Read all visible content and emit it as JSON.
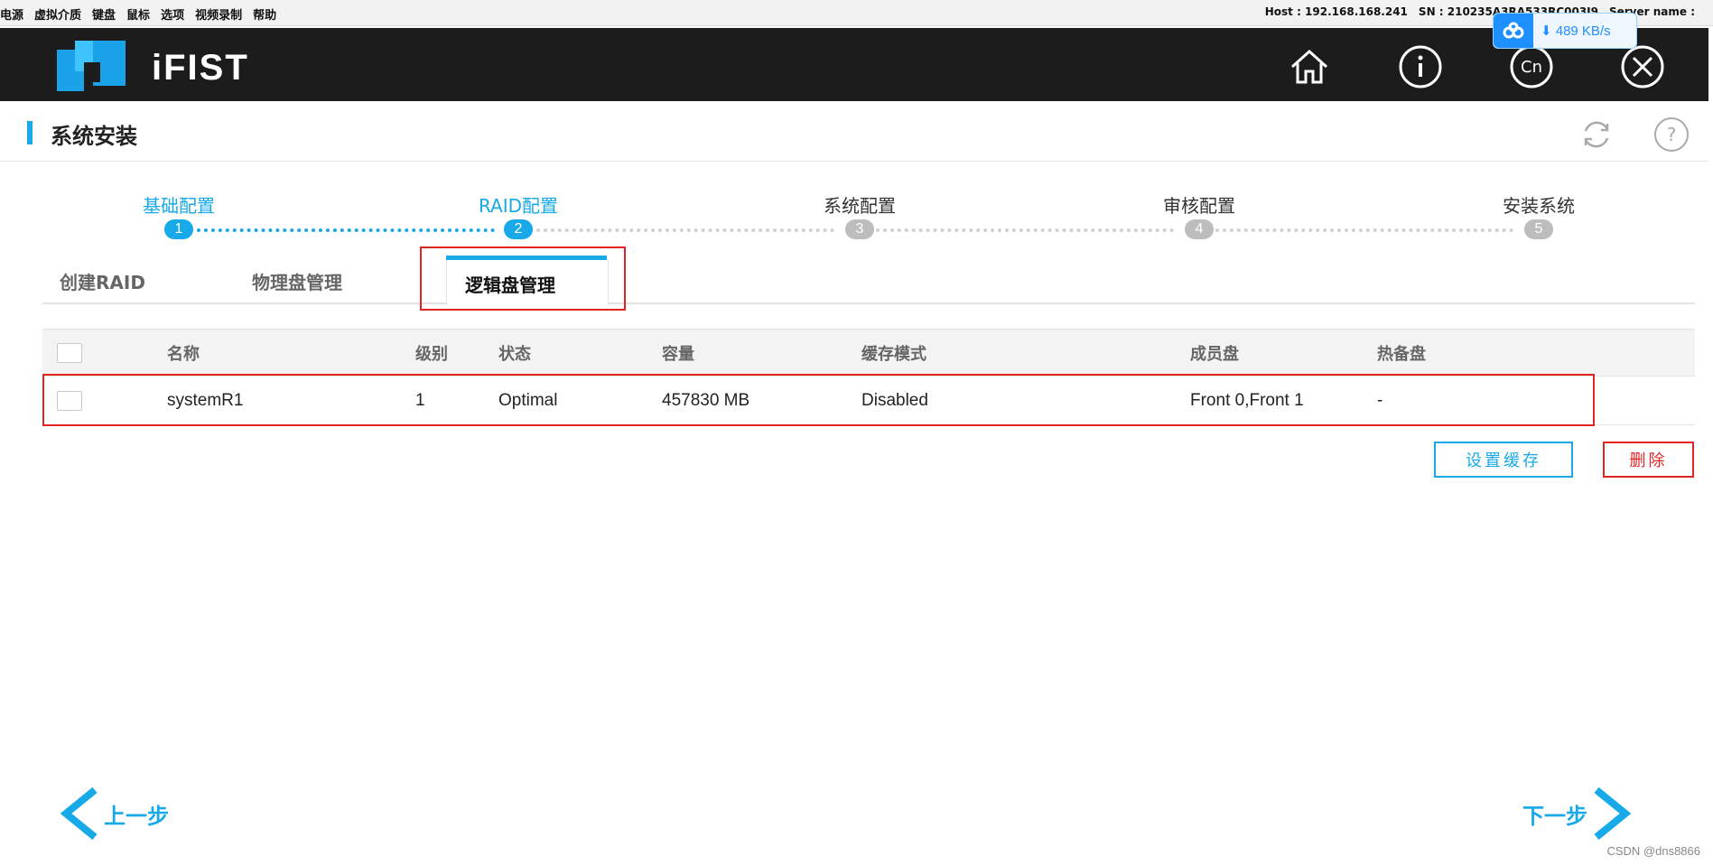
{
  "menubar": {
    "items": [
      "电源",
      "虚拟介质",
      "键盘",
      "鼠标",
      "选项",
      "视频录制",
      "帮助"
    ],
    "host": "Host : 192.168.168.241",
    "sn": "SN : 210235A3RA533RC003J9",
    "server": "Server name :"
  },
  "speed_badge": {
    "text": "⬇ 489 KB/s"
  },
  "header": {
    "brand": "iFIST"
  },
  "page": {
    "title": "系统安装"
  },
  "steps": [
    {
      "label": "基础配置",
      "num": "1"
    },
    {
      "label": "RAID配置",
      "num": "2"
    },
    {
      "label": "系统配置",
      "num": "3"
    },
    {
      "label": "审核配置",
      "num": "4"
    },
    {
      "label": "安装系统",
      "num": "5"
    }
  ],
  "tabs": [
    "创建RAID",
    "物理盘管理",
    "逻辑盘管理"
  ],
  "table": {
    "headers": [
      "名称",
      "级别",
      "状态",
      "容量",
      "缓存模式",
      "成员盘",
      "热备盘"
    ],
    "rows": [
      [
        "systemR1",
        "1",
        "Optimal",
        "457830 MB",
        "Disabled",
        "Front 0,Front 1",
        "-"
      ]
    ]
  },
  "actions": {
    "set_cache": "设置缓存",
    "delete": "删除"
  },
  "nav": {
    "prev": "上一步",
    "next": "下一步"
  },
  "watermark": "CSDN @dns8866",
  "colors": {
    "accent": "#17a9e8",
    "danger": "#e32222",
    "header_bg": "#1c1c1c",
    "inactive_step": "#bdbdbd"
  }
}
